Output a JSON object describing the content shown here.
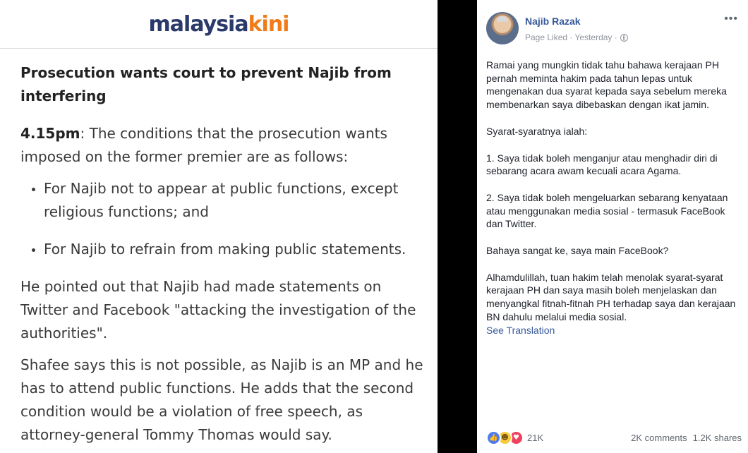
{
  "article": {
    "logo_part1": "malaysia",
    "logo_part2": "kini",
    "title": "Prosecution wants court to prevent Najib from interfering",
    "intro_time": "4.15pm",
    "intro_text": ": The conditions that the prosecution wants imposed on the former premier are as follows:",
    "bullets": [
      "For Najib not to appear at public functions, except religious functions; and",
      "For Najib to refrain from making public statements."
    ],
    "para2": "He pointed out that Najib had made statements on Twitter and Facebook \"attacking the investigation of the authorities\".",
    "para3": "Shafee says this is not possible, as Najib is an MP and he has to attend public functions. He adds that the second condition would be a violation of free speech, as attorney-general Tommy Thomas would say."
  },
  "post": {
    "author": "Najib Razak",
    "meta": "Page Liked · Yesterday ·",
    "more_label": "•••",
    "paragraphs": [
      "Ramai yang mungkin tidak tahu bahawa kerajaan PH pernah meminta hakim pada tahun lepas untuk mengenakan dua syarat kepada saya sebelum mereka membenarkan saya dibebaskan dengan ikat jamin.",
      "Syarat-syaratnya ialah:",
      "1. Saya tidak boleh menganjur atau menghadir diri di sebarang acara awam kecuali acara Agama.",
      "2. Saya tidak boleh mengeluarkan sebarang kenyataan atau menggunakan media sosial - termasuk FaceBook dan Twitter.",
      "Bahaya sangat ke, saya main FaceBook?",
      "Alhamdulillah, tuan hakim telah menolak syarat-syarat kerajaan PH dan saya masih boleh menjelaskan dan menyangkal fitnah-fitnah PH terhadap saya dan kerajaan BN dahulu melalui media sosial."
    ],
    "see_translation": "See Translation",
    "reactions": [
      "like-icon",
      "haha-icon",
      "love-icon"
    ],
    "reaction_count": "21K",
    "comments": "2K comments",
    "shares": "1.2K shares"
  }
}
